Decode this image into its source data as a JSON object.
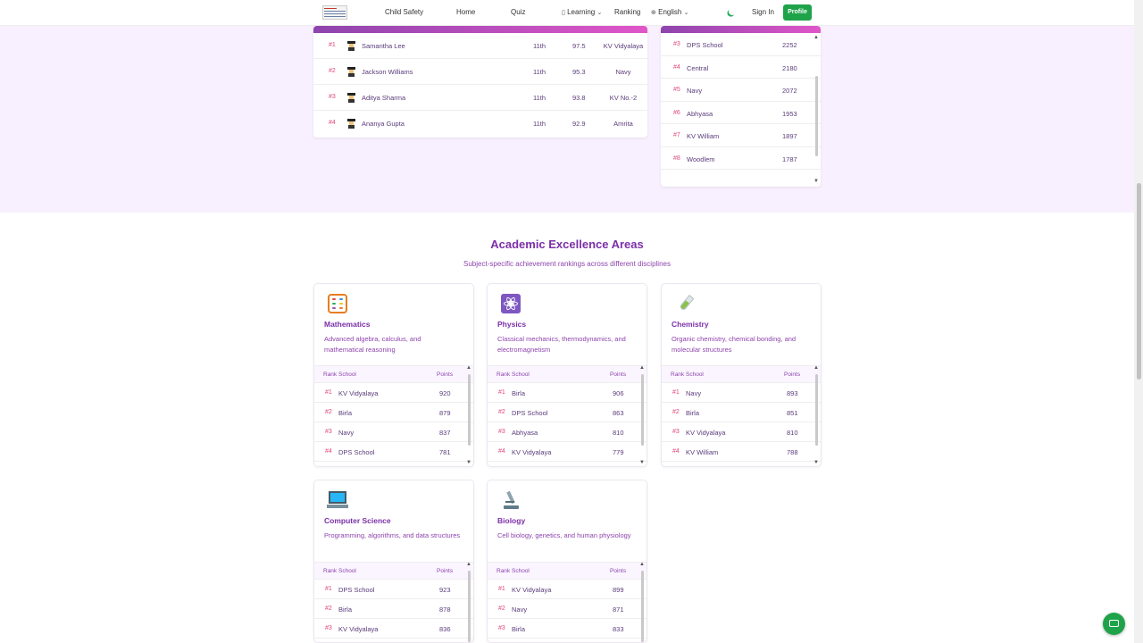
{
  "nav": {
    "links": [
      "Child Safety",
      "Home",
      "Quiz",
      "Learning",
      "Ranking",
      "English"
    ],
    "sign_in": "Sign In",
    "profile": "Profile"
  },
  "top_students": [
    {
      "rank": "#1",
      "name": "Samantha Lee",
      "grade": "11th",
      "score": "97.5",
      "school": "KV Vidyalaya"
    },
    {
      "rank": "#2",
      "name": "Jackson Williams",
      "grade": "11th",
      "score": "95.3",
      "school": "Navy"
    },
    {
      "rank": "#3",
      "name": "Aditya Sharma",
      "grade": "11th",
      "score": "93.8",
      "school": "KV No.-2"
    },
    {
      "rank": "#4",
      "name": "Ananya Gupta",
      "grade": "11th",
      "score": "92.9",
      "school": "Amrita"
    }
  ],
  "top_schools": [
    {
      "rank": "#3",
      "name": "DPS School",
      "points": "2252"
    },
    {
      "rank": "#4",
      "name": "Central",
      "points": "2180"
    },
    {
      "rank": "#5",
      "name": "Navy",
      "points": "2072"
    },
    {
      "rank": "#6",
      "name": "Abhyasa",
      "points": "1953"
    },
    {
      "rank": "#7",
      "name": "KV William",
      "points": "1897"
    },
    {
      "rank": "#8",
      "name": "Woodlem",
      "points": "1787"
    }
  ],
  "excellence": {
    "title": "Academic Excellence Areas",
    "subtitle": "Subject-specific achievement rankings across different disciplines",
    "headers": {
      "rank": "Rank",
      "school": "School",
      "points": "Points"
    },
    "subjects": [
      {
        "name": "Mathematics",
        "icon": "abacus-icon",
        "desc": "Advanced algebra, calculus, and mathematical reasoning",
        "rows": [
          {
            "rank": "#1",
            "school": "KV Vidyalaya",
            "points": "920"
          },
          {
            "rank": "#2",
            "school": "Birla",
            "points": "879"
          },
          {
            "rank": "#3",
            "school": "Navy",
            "points": "837"
          },
          {
            "rank": "#4",
            "school": "DPS School",
            "points": "781"
          }
        ]
      },
      {
        "name": "Physics",
        "icon": "atom-icon",
        "desc": "Classical mechanics, thermodynamics, and electromagnetism",
        "rows": [
          {
            "rank": "#1",
            "school": "Birla",
            "points": "906"
          },
          {
            "rank": "#2",
            "school": "DPS School",
            "points": "863"
          },
          {
            "rank": "#3",
            "school": "Abhyasa",
            "points": "810"
          },
          {
            "rank": "#4",
            "school": "KV Vidyalaya",
            "points": "779"
          }
        ]
      },
      {
        "name": "Chemistry",
        "icon": "test-tube-icon",
        "desc": "Organic chemistry, chemical bonding, and molecular structures",
        "rows": [
          {
            "rank": "#1",
            "school": "Navy",
            "points": "893"
          },
          {
            "rank": "#2",
            "school": "Birla",
            "points": "851"
          },
          {
            "rank": "#3",
            "school": "KV Vidyalaya",
            "points": "810"
          },
          {
            "rank": "#4",
            "school": "KV William",
            "points": "788"
          }
        ]
      },
      {
        "name": "Computer Science",
        "icon": "laptop-icon",
        "desc": "Programming, algorithms, and data structures",
        "rows": [
          {
            "rank": "#1",
            "school": "DPS School",
            "points": "923"
          },
          {
            "rank": "#2",
            "school": "Birla",
            "points": "878"
          },
          {
            "rank": "#3",
            "school": "KV Vidyalaya",
            "points": "836"
          }
        ]
      },
      {
        "name": "Biology",
        "icon": "microscope-icon",
        "desc": "Cell biology, genetics, and human physiology",
        "rows": [
          {
            "rank": "#1",
            "school": "KV Vidyalaya",
            "points": "899"
          },
          {
            "rank": "#2",
            "school": "Navy",
            "points": "871"
          },
          {
            "rank": "#3",
            "school": "Birla",
            "points": "833"
          }
        ]
      }
    ]
  },
  "colors": {
    "accent": "#7b2fa8",
    "rank": "#e0457b",
    "brand_green": "#1fa34a",
    "section_bg": "#f8f0ff"
  }
}
